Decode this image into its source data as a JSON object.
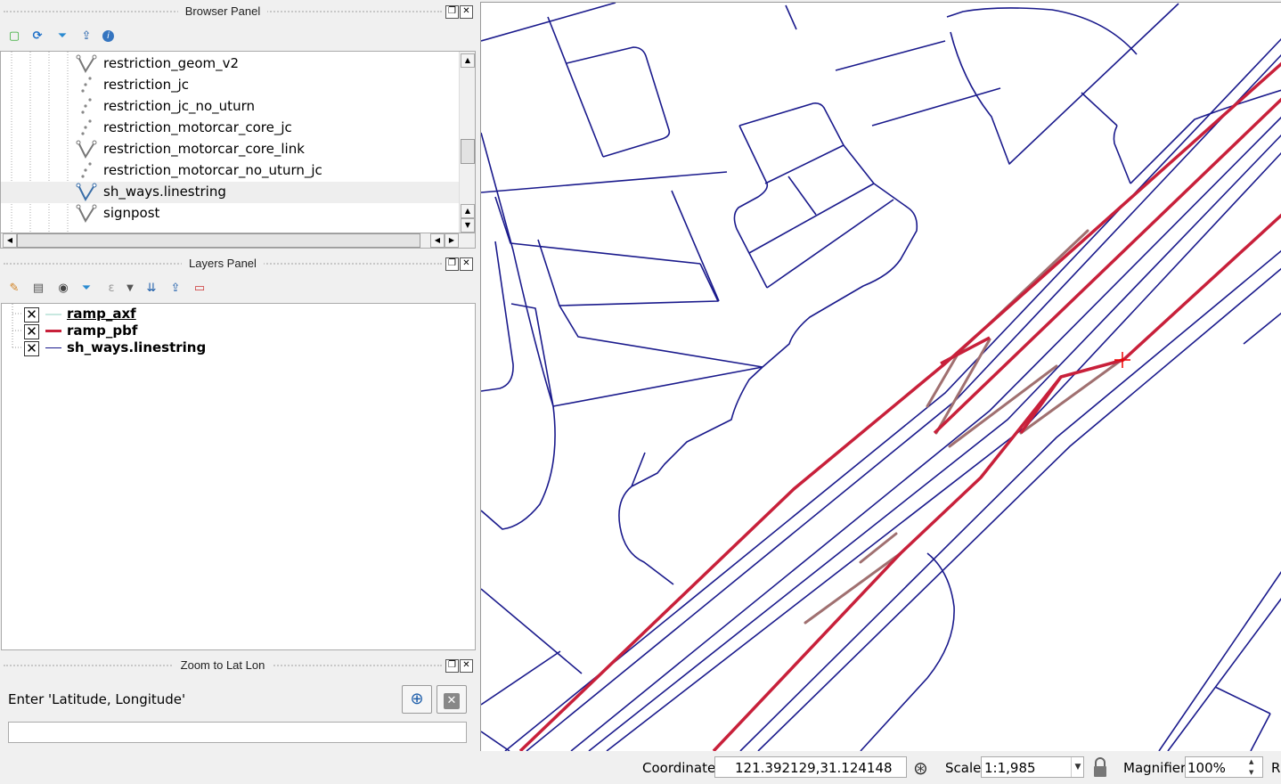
{
  "browser_panel": {
    "title": "Browser Panel",
    "items": [
      {
        "label": "restriction_geom_v2",
        "icon": "line-layer-icon",
        "selected": false
      },
      {
        "label": "restriction_jc",
        "icon": "point-layer-icon",
        "selected": false
      },
      {
        "label": "restriction_jc_no_uturn",
        "icon": "point-layer-icon",
        "selected": false
      },
      {
        "label": "restriction_motorcar_core_jc",
        "icon": "point-layer-icon",
        "selected": false
      },
      {
        "label": "restriction_motorcar_core_link",
        "icon": "line-layer-icon",
        "selected": false
      },
      {
        "label": "restriction_motorcar_no_uturn_jc",
        "icon": "point-layer-icon",
        "selected": false
      },
      {
        "label": "sh_ways.linestring",
        "icon": "line-layer-icon",
        "selected": true
      },
      {
        "label": "signpost",
        "icon": "line-layer-icon",
        "selected": false
      }
    ]
  },
  "layers_panel": {
    "title": "Layers Panel",
    "layers": [
      {
        "name": "ramp_axf",
        "checked": "✕",
        "color": "#c8e8e0",
        "underline": true
      },
      {
        "name": "ramp_pbf",
        "checked": "✕",
        "color": "#c8203a",
        "underline": false
      },
      {
        "name": "sh_ways.linestring",
        "checked": "✕",
        "color": "#1a1a8c",
        "underline": false
      }
    ]
  },
  "zoom_panel": {
    "title": "Zoom to Lat Lon",
    "prompt": "Enter 'Latitude, Longitude'",
    "input_value": ""
  },
  "statusbar": {
    "coordinate_label": "Coordinate",
    "coordinate_value": "121.392129,31.124148",
    "scale_label": "Scale",
    "scale_value": "1:1,985",
    "magnifier_label": "Magnifier",
    "magnifier_value": "100%",
    "trailing": "R"
  },
  "colors": {
    "road": "#1a1a8c",
    "ramp": "#c8203a",
    "ramp_outline": "#a07070"
  }
}
